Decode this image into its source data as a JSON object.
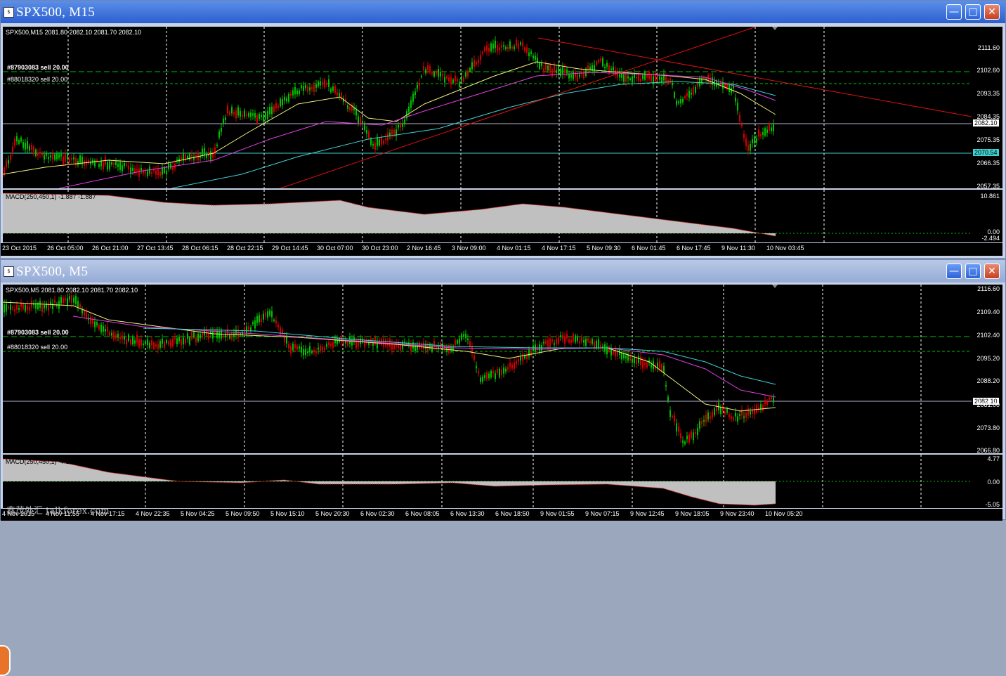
{
  "windows": [
    {
      "title": "SPX500, M15",
      "header": "SPX500,M15  2081.80 2082.10 2081.70 2082.10",
      "orders": [
        {
          "text": "#87903083 sell 20.00",
          "bold": true
        },
        {
          "text": "#88018320 sell 20.00",
          "bold": false
        }
      ],
      "price_ticks": [
        "2111.60",
        "2102.60",
        "2093.35",
        "2084.35",
        "2075.35",
        "2066.35",
        "2057.35"
      ],
      "price_tag": "2082.10",
      "level_tag": "2070.54",
      "macd_label": "MACD(250,450,1) -1.887 -1.887",
      "macd_ticks": [
        "10.861",
        "0.00",
        "-2.494"
      ],
      "time_ticks": [
        "23 Oct 2015",
        "26 Oct 05:00",
        "26 Oct 21:00",
        "27 Oct 13:45",
        "28 Oct 06:15",
        "28 Oct 22:15",
        "29 Oct 14:45",
        "30 Oct 07:00",
        "30 Oct 23:00",
        "2 Nov 16:45",
        "3 Nov 09:00",
        "4 Nov 01:15",
        "4 Nov 17:15",
        "5 Nov 09:30",
        "6 Nov 01:45",
        "6 Nov 17:45",
        "9 Nov 11:30",
        "10 Nov 03:45"
      ]
    },
    {
      "title": "SPX500, M5",
      "header": "SPX500,M5  2081.80 2082.10 2081.70 2082.10",
      "orders": [
        {
          "text": "#87903083 sell 20.00",
          "bold": true
        },
        {
          "text": "#88018320 sell 20.00",
          "bold": false
        }
      ],
      "price_ticks": [
        "2116.60",
        "2109.40",
        "2102.40",
        "2095.20",
        "2088.20",
        "2081.00",
        "2073.80",
        "2066.80"
      ],
      "price_tag": "2082.10",
      "macd_label": "MACD(250,450,1) -4.160 -4.160",
      "macd_ticks": [
        "4.77",
        "0.00",
        "-5.05"
      ],
      "time_ticks": [
        "4 Nov 2015",
        "4 Nov 11:55",
        "4 Nov 17:15",
        "4 Nov 22:35",
        "5 Nov 04:25",
        "5 Nov 09:50",
        "5 Nov 15:10",
        "5 Nov 20:30",
        "6 Nov 02:30",
        "6 Nov 08:05",
        "6 Nov 13:30",
        "6 Nov 18:50",
        "9 Nov 01:55",
        "9 Nov 07:15",
        "9 Nov 12:45",
        "9 Nov 18:05",
        "9 Nov 23:40",
        "10 Nov 05:20"
      ]
    }
  ],
  "watermark": "鑫茂外汇 talkforex.com",
  "colors": {
    "up": "#00c000",
    "down": "#d00000",
    "ma_yellow": "#f0f080",
    "ma_magenta": "#e040e0",
    "ma_cyan": "#40d0d0",
    "trend": "#e01010",
    "order_line": "#00c000",
    "macd": "#c0c0c0"
  }
}
